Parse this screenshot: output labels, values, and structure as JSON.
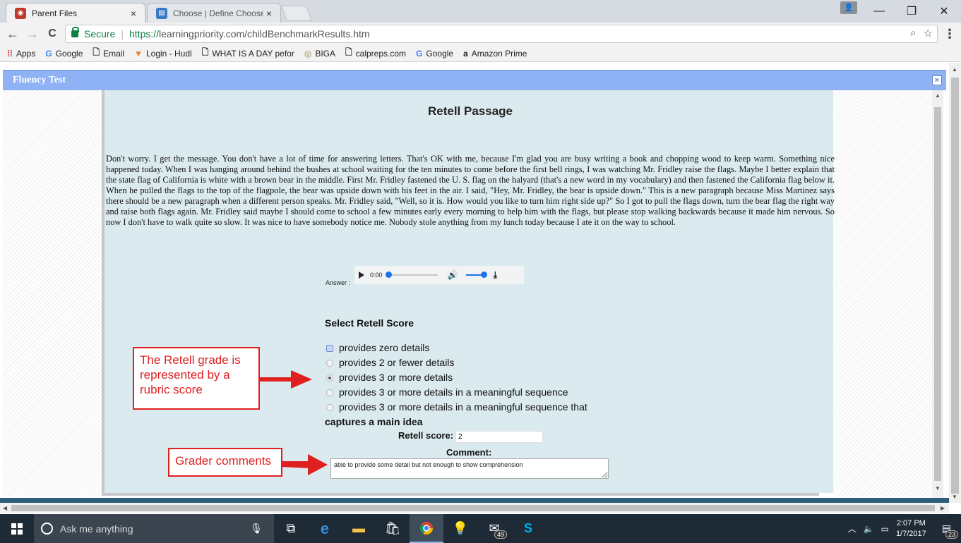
{
  "browser": {
    "tabs": [
      {
        "label": "Parent Files",
        "icon": "owl-icon",
        "close": "×"
      },
      {
        "label": "Choose | Define Choose",
        "icon": "dictionary-icon",
        "close": "×"
      }
    ],
    "back": "←",
    "forward": "→",
    "reload": "C",
    "secure_label": "Secure",
    "url_scheme": "https://",
    "url_rest": "learningpriority.com/childBenchmarkResults.htm",
    "menu": "⋮",
    "bookmarks": [
      {
        "label": "Apps",
        "icon": "apps-grid-icon"
      },
      {
        "label": "Google",
        "icon": "google-icon"
      },
      {
        "label": "Email",
        "icon": "page-icon"
      },
      {
        "label": "Login - Hudl",
        "icon": "hudl-icon"
      },
      {
        "label": "WHAT IS A DAY pefor",
        "icon": "page-icon"
      },
      {
        "label": "BIGA",
        "icon": "biga-icon"
      },
      {
        "label": "calpreps.com",
        "icon": "page-icon"
      },
      {
        "label": "Google",
        "icon": "google-icon"
      },
      {
        "label": "Amazon Prime",
        "icon": "amazon-icon"
      }
    ]
  },
  "modal": {
    "title": "Fluency Test",
    "close": "×"
  },
  "passage": {
    "heading": "Retell Passage",
    "text": "Don't worry. I get the message. You don't have a lot of time for answering letters. That's OK with me, because I'm glad you are busy writing a book and chopping wood to keep warm. Something nice happened today. When I was hanging around behind the bushes at school waiting for the ten minutes to come before the first bell rings, I was watching Mr. Fridley raise the flags. Maybe I better explain that the state flag of California is white with a brown bear in the middle. First Mr. Fridley fastened the U. S. flag on the halyard (that's a new word in my vocabulary) and then fastened the California flag below it. When he pulled the flags to the top of the flagpole, the bear was upside down with his feet in the air. I said, \"Hey, Mr. Fridley, the bear is upside down.\" This is a new paragraph because Miss Martinez says there should be a new paragraph when a different person speaks. Mr. Fridley said, \"Well, so it is. How would you like to turn him right side up?\" So I got to pull the flags down, turn the bear flag the right way and raise both flags again. Mr. Fridley said maybe I should come to school a few minutes early every morning to help him with the flags, but please stop walking backwards because it made him nervous. So now I don't have to walk quite so slow. It was nice to have somebody notice me. Nobody stole anything from my lunch today because I ate it on the way to school."
  },
  "answer": {
    "label": "Answer :",
    "time": "0:00",
    "progress": 0,
    "volume": 1
  },
  "retell": {
    "title": "Select Retell Score",
    "options": [
      {
        "label": "provides zero details"
      },
      {
        "label": "provides 2 or fewer details"
      },
      {
        "label": "provides 3 or more details",
        "checked": true
      },
      {
        "label": "provides 3 or more details in a meaningful sequence"
      },
      {
        "label": "provides 3 or more details in a meaningful sequence that",
        "continuation": "captures a main idea"
      }
    ],
    "score_label": "Retell score:",
    "score_value": "2",
    "comment_label": "Comment:",
    "comment_value": "able to provide some detail but not enough to show comprehension"
  },
  "annotations": {
    "callout1": "The Retell grade is represented by a rubric score",
    "callout2": "Grader comments",
    "color": "#e02020"
  },
  "taskbar": {
    "search_placeholder": "Ask me anything",
    "mail_badge": "49",
    "time": "2:07 PM",
    "date": "1/7/2017",
    "notifications": "23"
  }
}
